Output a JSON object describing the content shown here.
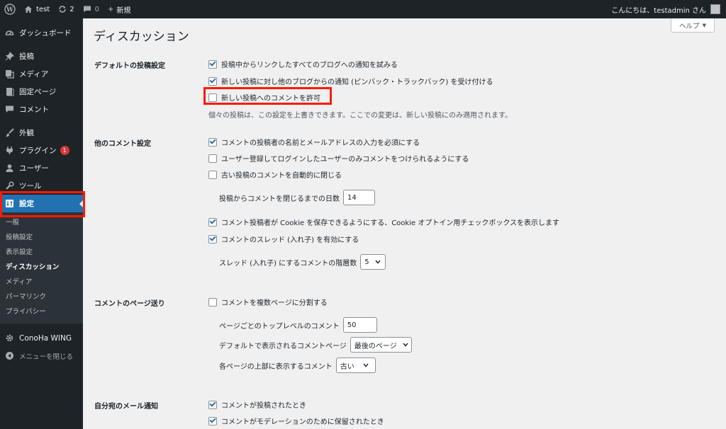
{
  "adminbar": {
    "site_name": "test",
    "updates_count": "2",
    "comments_count": "0",
    "new_label": "新規",
    "greeting": "こんにちは、testadmin さん"
  },
  "sidebar": {
    "dashboard": "ダッシュボード",
    "posts": "投稿",
    "media": "メディア",
    "pages": "固定ページ",
    "comments": "コメント",
    "appearance": "外観",
    "plugins": "プラグイン",
    "plugins_badge": "1",
    "users": "ユーザー",
    "tools": "ツール",
    "settings": "設定",
    "submenu": [
      "一般",
      "投稿設定",
      "表示設定",
      "ディスカッション",
      "メディア",
      "パーマリンク",
      "プライバシー"
    ],
    "conoha": "ConoHa WING",
    "collapse": "メニューを閉じる"
  },
  "main": {
    "help": "ヘルプ",
    "title": "ディスカッション",
    "default_post_settings": {
      "label": "デフォルトの投稿設定",
      "items": [
        "投稿中からリンクしたすべてのブログへの通知を試みる",
        "新しい投稿に対し他のブログからの通知 (ピンバック・トラックバック) を受け付ける",
        "新しい投稿へのコメントを許可"
      ],
      "note": "個々の投稿は、この設定を上書きできます。ここでの変更は、新しい投稿にのみ適用されます。"
    },
    "other_comment_settings": {
      "label": "他のコメント設定",
      "items": [
        "コメントの投稿者の名前とメールアドレスの入力を必須にする",
        "ユーザー登録してログインしたユーザーのみコメントをつけられるようにする",
        "古い投稿のコメントを自動的に閉じる"
      ],
      "close_days_label": "投稿からコメントを閉じるまでの日数",
      "close_days_value": "14",
      "cookie": "コメント投稿者が Cookie を保存できるようにする、Cookie オプトイン用チェックボックスを表示します",
      "threaded": "コメントのスレッド (入れ子) を有効にする",
      "thread_depth_label": "スレッド (入れ子) にするコメントの階層数",
      "thread_depth_value": "5"
    },
    "comment_pagination": {
      "label": "コメントのページ送り",
      "break": "コメントを複数ページに分割する",
      "per_page_label": "ページごとのトップレベルのコメント",
      "per_page_value": "50",
      "default_page_label": "デフォルトで表示されるコメントページ",
      "default_page_value": "最後のページ",
      "order_label": "各ページの上部に表示するコメント",
      "order_value": "古い"
    },
    "email_me": {
      "label": "自分宛のメール通知",
      "items": [
        "コメントが投稿されたとき",
        "コメントがモデレーションのために保留されたとき"
      ]
    }
  },
  "colors": {
    "highlight": "#ff1a00",
    "accent": "#2271b1",
    "sidebar_bg": "#1d2327"
  }
}
